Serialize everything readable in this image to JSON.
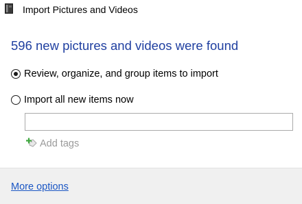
{
  "window": {
    "title": "Import Pictures and Videos",
    "icon": "camera-device-icon"
  },
  "main": {
    "headline": "596 new pictures and videos were found",
    "options": [
      {
        "label": "Review, organize, and group items to import",
        "selected": true
      },
      {
        "label": "Import all new items now",
        "selected": false
      }
    ],
    "tag_input": {
      "value": "",
      "placeholder": ""
    },
    "add_tags": {
      "label": "Add tags",
      "icon": "add-tag-icon",
      "enabled": false
    }
  },
  "footer": {
    "more_options_label": "More options"
  },
  "colors": {
    "headline": "#1f3fa0",
    "link": "#1a56c4",
    "disabled_text": "#9a9a9a",
    "footer_bg": "#f0f0f0"
  }
}
